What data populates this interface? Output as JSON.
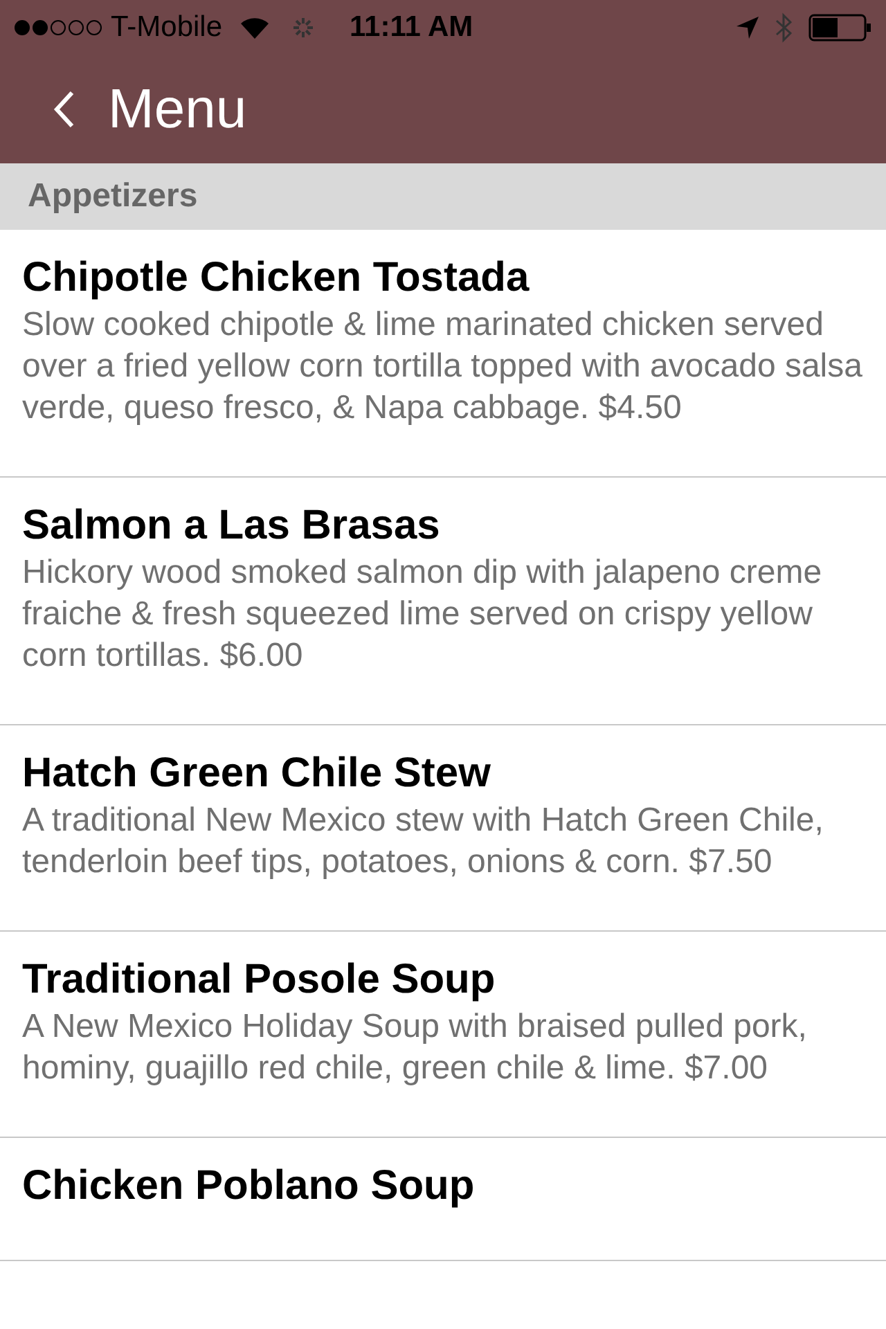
{
  "status_bar": {
    "carrier": "T-Mobile",
    "time": "11:11 AM"
  },
  "nav": {
    "title": "Menu"
  },
  "section": {
    "title": "Appetizers"
  },
  "items": [
    {
      "name": "Chipotle Chicken Tostada",
      "description": "Slow cooked chipotle & lime marinated chicken served over a fried yellow corn tortilla topped with avocado salsa verde, queso fresco, & Napa cabbage. $4.50"
    },
    {
      "name": "Salmon a Las Brasas",
      "description": "Hickory wood smoked salmon dip with jalapeno creme fraiche & fresh squeezed lime served on crispy yellow corn tortillas. $6.00"
    },
    {
      "name": "Hatch Green Chile Stew",
      "description": "A traditional New Mexico stew with Hatch Green Chile, tenderloin beef tips, potatoes, onions & corn. $7.50"
    },
    {
      "name": "Traditional Posole Soup",
      "description": "A New Mexico Holiday Soup with braised pulled pork, hominy, guajillo red chile, green chile & lime. $7.00"
    },
    {
      "name": "Chicken Poblano Soup"
    }
  ]
}
